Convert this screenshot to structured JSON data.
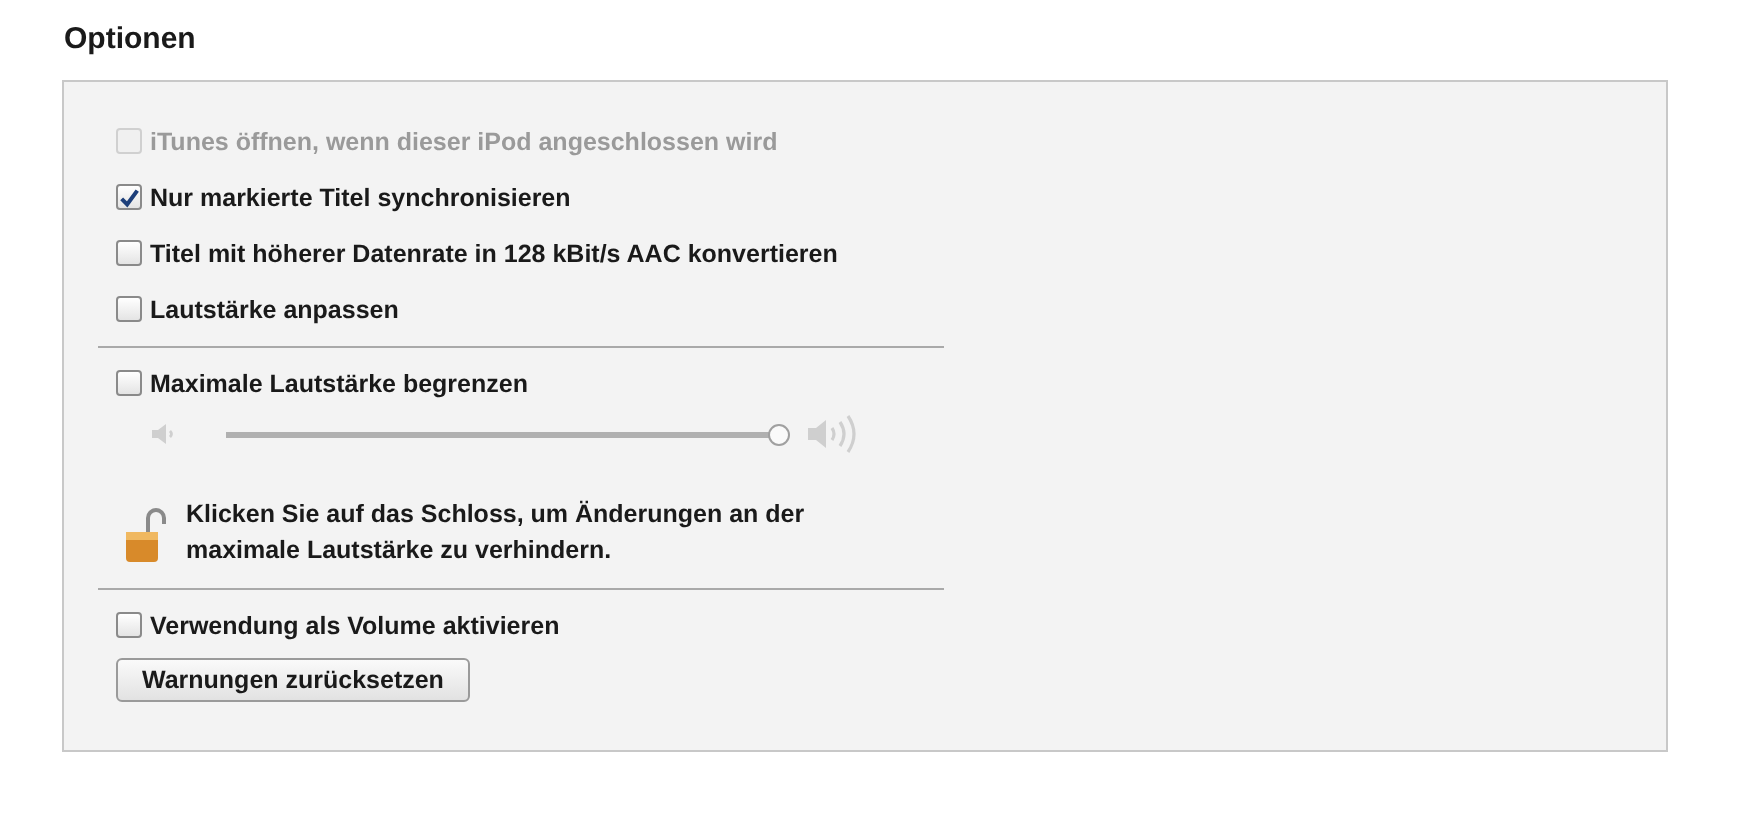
{
  "heading": "Optionen",
  "sections": [
    {
      "items": [
        {
          "kind": "checkbox",
          "label": "iTunes öffnen, wenn dieser iPod angeschlossen wird",
          "checked": false,
          "disabled": true
        },
        {
          "kind": "checkbox",
          "label": "Nur markierte Titel synchronisieren",
          "checked": true,
          "disabled": false
        },
        {
          "kind": "checkbox",
          "label": "Titel mit höherer Datenrate in 128 kBit/s AAC konvertieren",
          "checked": false,
          "disabled": false
        },
        {
          "kind": "checkbox",
          "label": "Lautstärke anpassen",
          "checked": false,
          "disabled": false
        }
      ]
    },
    {
      "items": [
        {
          "kind": "checkbox",
          "label": "Maximale Lautstärke begrenzen",
          "checked": false,
          "disabled": false
        },
        {
          "kind": "slider",
          "level": 1.0
        },
        {
          "kind": "lock_note",
          "text": "Klicken Sie auf das Schloss, um Änderungen an der maximale Lautstärke zu verhindern."
        }
      ]
    },
    {
      "items": [
        {
          "kind": "checkbox",
          "label": "Verwendung als Volume aktivieren",
          "checked": false,
          "disabled": false
        },
        {
          "kind": "button",
          "label": "Warnungen zurücksetzen"
        }
      ]
    }
  ]
}
